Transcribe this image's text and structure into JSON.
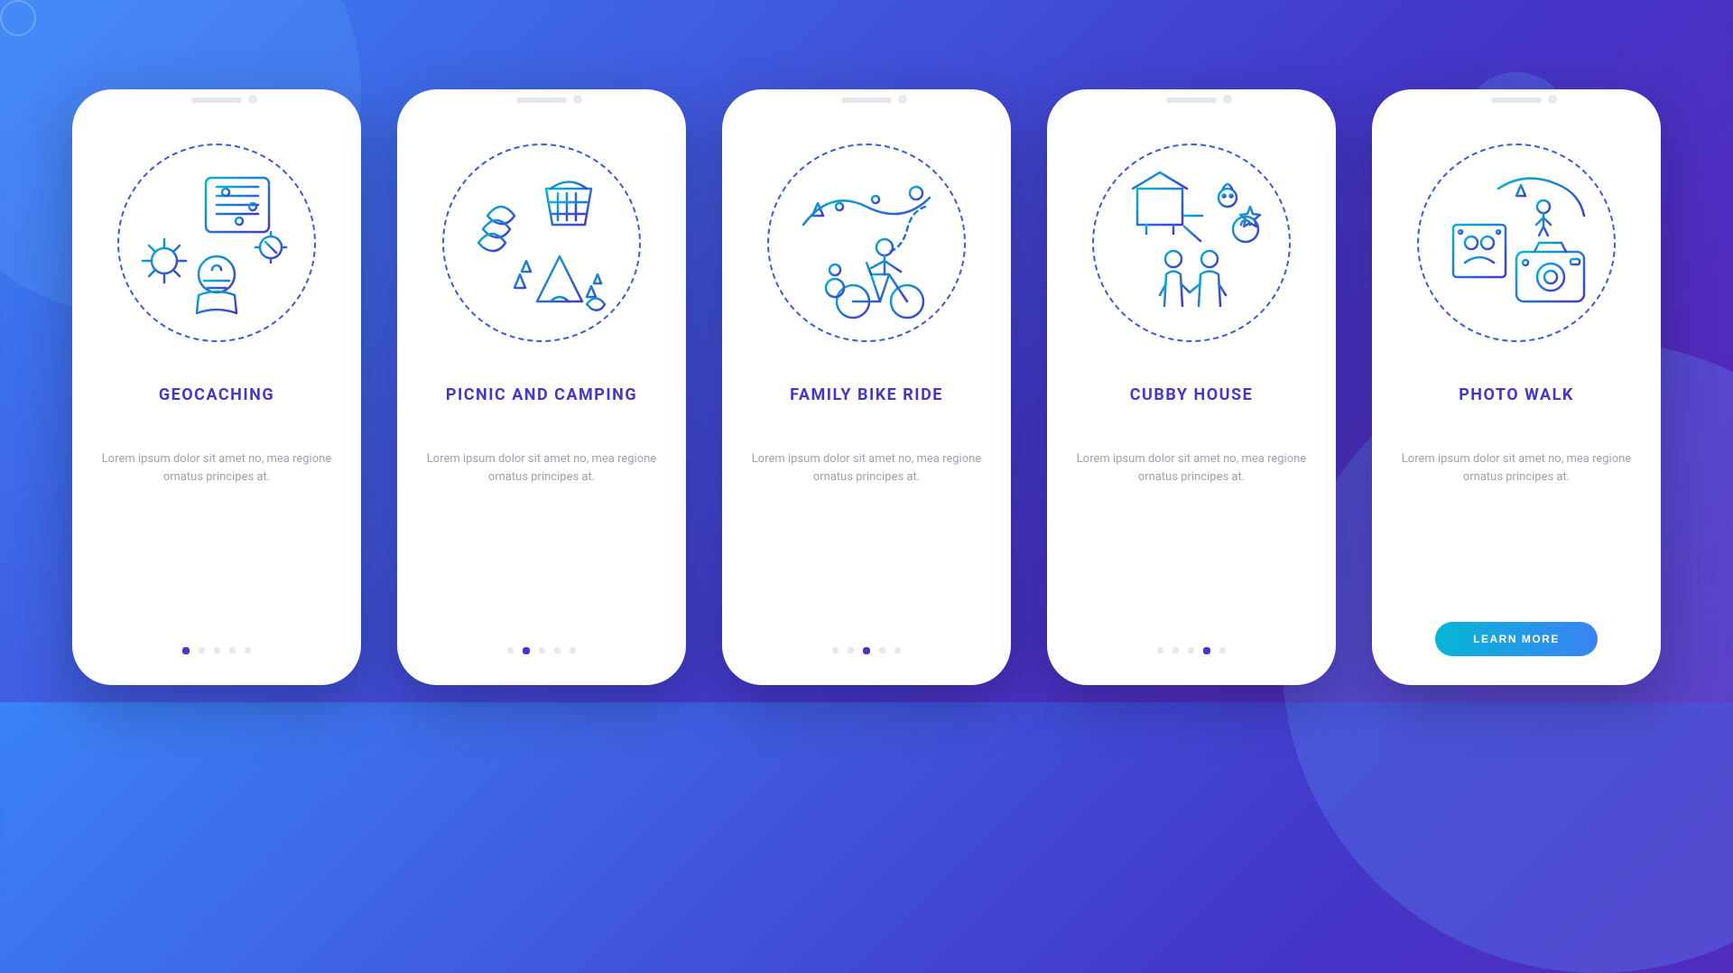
{
  "screens": [
    {
      "title": "GEOCACHING",
      "description": "Lorem ipsum dolor sit amet no, mea regione ornatus principes at."
    },
    {
      "title": "PICNIC AND CAMPING",
      "description": "Lorem ipsum dolor sit amet no, mea regione ornatus principes at."
    },
    {
      "title": "FAMILY BIKE RIDE",
      "description": "Lorem ipsum dolor sit amet no, mea regione ornatus principes at."
    },
    {
      "title": "CUBBY HOUSE",
      "description": "Lorem ipsum dolor sit amet no, mea regione ornatus principes at."
    },
    {
      "title": "PHOTO WALK",
      "description": "Lorem ipsum dolor sit amet no, mea regione ornatus principes at."
    }
  ],
  "cta_label": "LEARN MORE",
  "dots_count": 5,
  "colors": {
    "accent": "#4338ca",
    "gradient_start": "#06b6d4",
    "gradient_end": "#3b82f6"
  }
}
